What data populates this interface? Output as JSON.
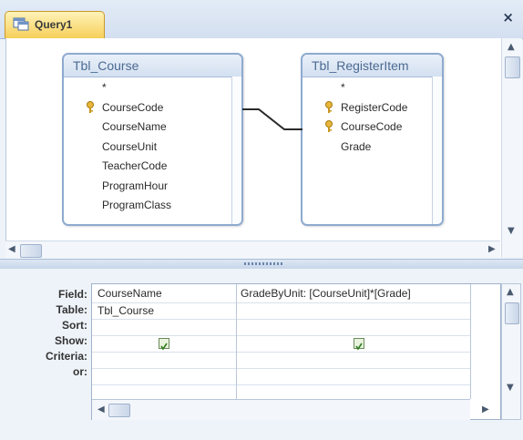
{
  "tab": {
    "label": "Query1",
    "close": "×"
  },
  "tables": [
    {
      "title": "Tbl_Course",
      "fields": [
        {
          "name": "*",
          "key": false
        },
        {
          "name": "CourseCode",
          "key": true
        },
        {
          "name": "CourseName",
          "key": false
        },
        {
          "name": "CourseUnit",
          "key": false
        },
        {
          "name": "TeacherCode",
          "key": false
        },
        {
          "name": "ProgramHour",
          "key": false
        },
        {
          "name": "ProgramClass",
          "key": false
        }
      ]
    },
    {
      "title": "Tbl_RegisterItem",
      "fields": [
        {
          "name": "*",
          "key": false
        },
        {
          "name": "RegisterCode",
          "key": true
        },
        {
          "name": "CourseCode",
          "key": true
        },
        {
          "name": "Grade",
          "key": false
        }
      ]
    }
  ],
  "grid": {
    "row_labels": [
      "Field:",
      "Table:",
      "Sort:",
      "Show:",
      "Criteria:",
      "or:"
    ],
    "columns": [
      {
        "field": "CourseName",
        "table": "Tbl_Course",
        "show": true
      },
      {
        "field": "GradeByUnit: [CourseUnit]*[Grade]",
        "table": "",
        "show": true
      }
    ]
  }
}
